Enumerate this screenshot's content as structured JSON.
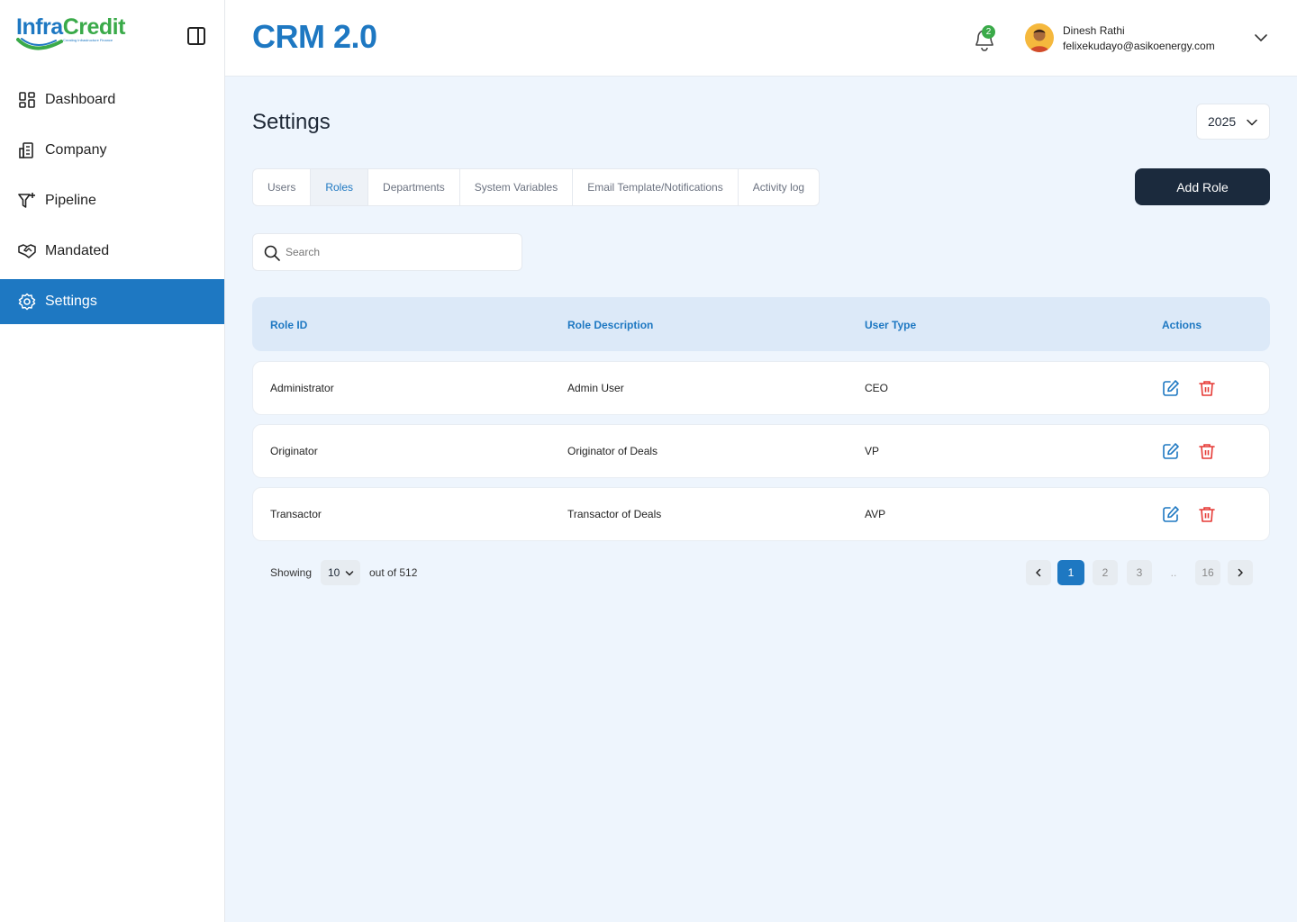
{
  "brand": {
    "name_part1": "Infra",
    "name_part2": "Credit",
    "tagline": "Creating Infrastructure Finance"
  },
  "sidebar": {
    "items": [
      {
        "label": "Dashboard",
        "icon": "dashboard-icon"
      },
      {
        "label": "Company",
        "icon": "building-icon"
      },
      {
        "label": "Pipeline",
        "icon": "filter-plus-icon"
      },
      {
        "label": "Mandated",
        "icon": "handshake-icon"
      },
      {
        "label": "Settings",
        "icon": "gear-icon",
        "active": true
      }
    ]
  },
  "header": {
    "title": "CRM 2.0",
    "notification_count": "2",
    "user_name": "Dinesh Rathi",
    "user_email": "felixekudayo@asikoenergy.com"
  },
  "page": {
    "title": "Settings",
    "year": "2025",
    "tabs": [
      "Users",
      "Roles",
      "Departments",
      "System Variables",
      "Email Template/Notifications",
      "Activity log"
    ],
    "active_tab": "Roles",
    "add_button": "Add Role",
    "search_placeholder": "Search"
  },
  "table": {
    "columns": [
      "Role ID",
      "Role Description",
      "User Type",
      "Actions"
    ],
    "rows": [
      {
        "role_id": "Administrator",
        "description": "Admin User",
        "user_type": "CEO"
      },
      {
        "role_id": "Originator",
        "description": "Originator of Deals",
        "user_type": "VP"
      },
      {
        "role_id": "Transactor",
        "description": "Transactor of Deals",
        "user_type": "AVP"
      }
    ]
  },
  "pagination": {
    "showing_label": "Showing",
    "per_page": "10",
    "total_label": "out of 512",
    "pages": [
      "1",
      "2",
      "3",
      "..",
      "16"
    ],
    "current": "1"
  },
  "colors": {
    "primary": "#1e78c2",
    "accent": "#3aaa49",
    "dark_button": "#1b2a3d",
    "danger": "#e53935"
  }
}
